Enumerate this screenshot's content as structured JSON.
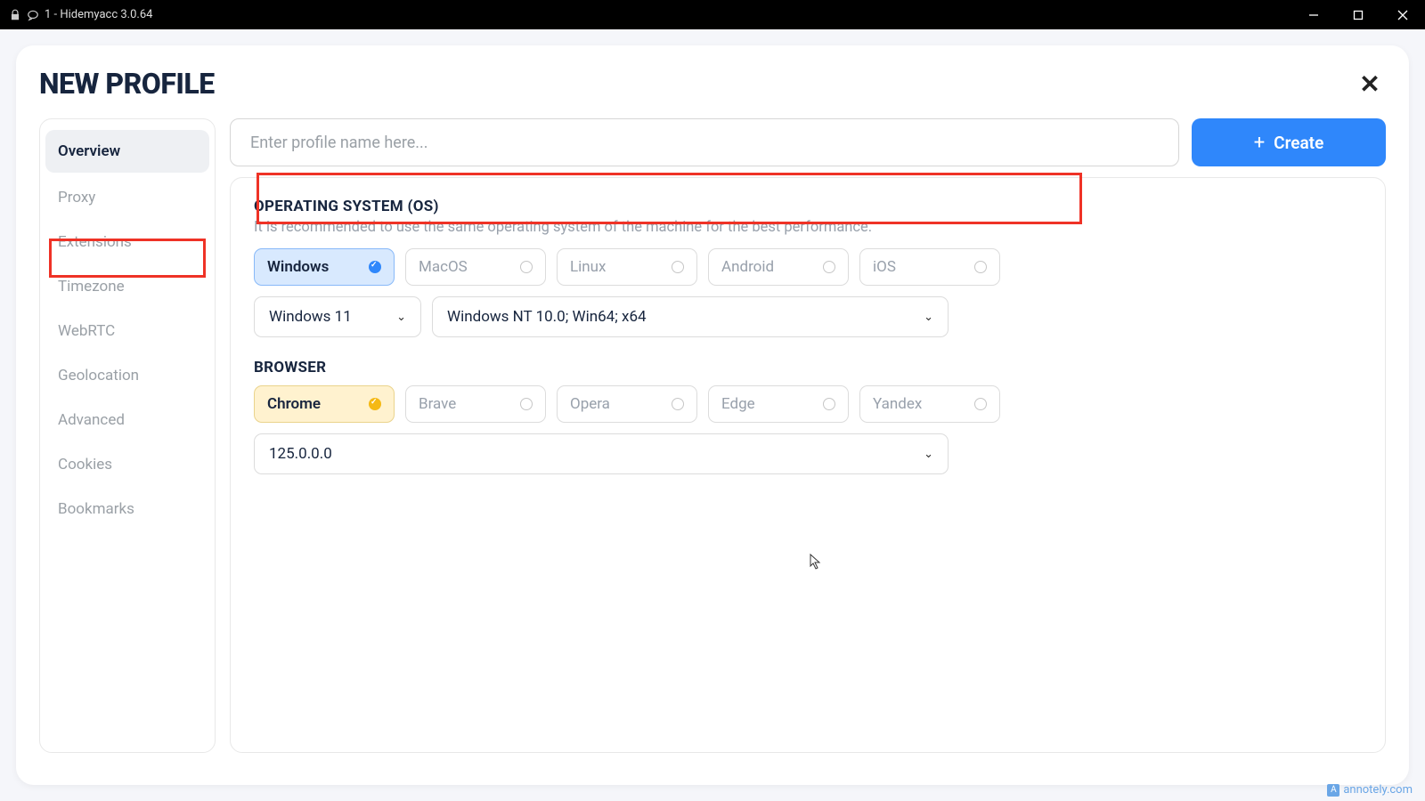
{
  "titlebar": {
    "text": "1 - Hidemyacc 3.0.64"
  },
  "modal": {
    "title": "NEW PROFILE"
  },
  "sidebar": {
    "items": [
      {
        "label": "Overview",
        "active": true
      },
      {
        "label": "Proxy"
      },
      {
        "label": "Extensions"
      },
      {
        "label": "Timezone"
      },
      {
        "label": "WebRTC"
      },
      {
        "label": "Geolocation"
      },
      {
        "label": "Advanced"
      },
      {
        "label": "Cookies"
      },
      {
        "label": "Bookmarks"
      }
    ]
  },
  "nameInput": {
    "placeholder": "Enter profile name here..."
  },
  "createBtn": {
    "label": "Create"
  },
  "os": {
    "title": "OPERATING SYSTEM (OS)",
    "subtitle": "It is recommended to use the same operating system of the machine for the best performance.",
    "options": [
      "Windows",
      "MacOS",
      "Linux",
      "Android",
      "iOS"
    ],
    "versionSelect": "Windows 11",
    "uaSelect": "Windows NT 10.0; Win64; x64"
  },
  "browser": {
    "title": "BROWSER",
    "options": [
      "Chrome",
      "Brave",
      "Opera",
      "Edge",
      "Yandex"
    ],
    "versionSelect": "125.0.0.0"
  },
  "watermark": "annotely.com"
}
